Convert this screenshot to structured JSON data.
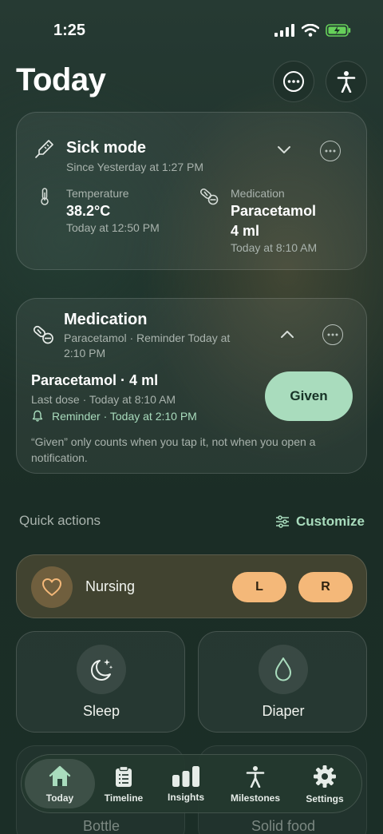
{
  "status_bar": {
    "time": "1:25"
  },
  "header": {
    "title": "Today"
  },
  "sick_mode": {
    "title": "Sick mode",
    "subtitle": "Since Yesterday at 1:27 PM",
    "temperature": {
      "label": "Temperature",
      "value": "38.2°C",
      "time": "Today at 12:50 PM"
    },
    "medication": {
      "label": "Medication",
      "name": "Paracetamol",
      "dose": "4 ml",
      "time": "Today at 8:10 AM"
    }
  },
  "medication_card": {
    "title": "Medication",
    "subtitle_line1": "Paracetamol · Reminder Today at",
    "subtitle_line2": "2:10 PM",
    "dose_title": "Paracetamol · 4 ml",
    "last_dose": "Last dose · Today at 8:10 AM",
    "reminder": "Reminder · Today at 2:10 PM",
    "given_label": "Given",
    "note_line1": "“Given” only counts when you tap it, not when you open a",
    "note_line2": "notification."
  },
  "quick_actions": {
    "title": "Quick actions",
    "customize_label": "Customize",
    "nursing": {
      "label": "Nursing",
      "left": "L",
      "right": "R"
    },
    "tiles": [
      {
        "label": "Sleep",
        "icon": "moon-stars-icon"
      },
      {
        "label": "Diaper",
        "icon": "drop-icon"
      },
      {
        "label": "Bottle",
        "icon": "bottle-icon"
      },
      {
        "label": "Solid food",
        "icon": "food-icon"
      }
    ]
  },
  "tabbar": {
    "tabs": [
      {
        "label": "Today",
        "icon": "home-icon",
        "active": true
      },
      {
        "label": "Timeline",
        "icon": "clipboard-icon"
      },
      {
        "label": "Insights",
        "icon": "bar-chart-icon"
      },
      {
        "label": "Milestones",
        "icon": "person-icon"
      },
      {
        "label": "Settings",
        "icon": "gear-icon"
      }
    ]
  },
  "colors": {
    "accent": "#a9dcbd",
    "nursing": "#f4b879",
    "customize": "#a9dcbd"
  }
}
